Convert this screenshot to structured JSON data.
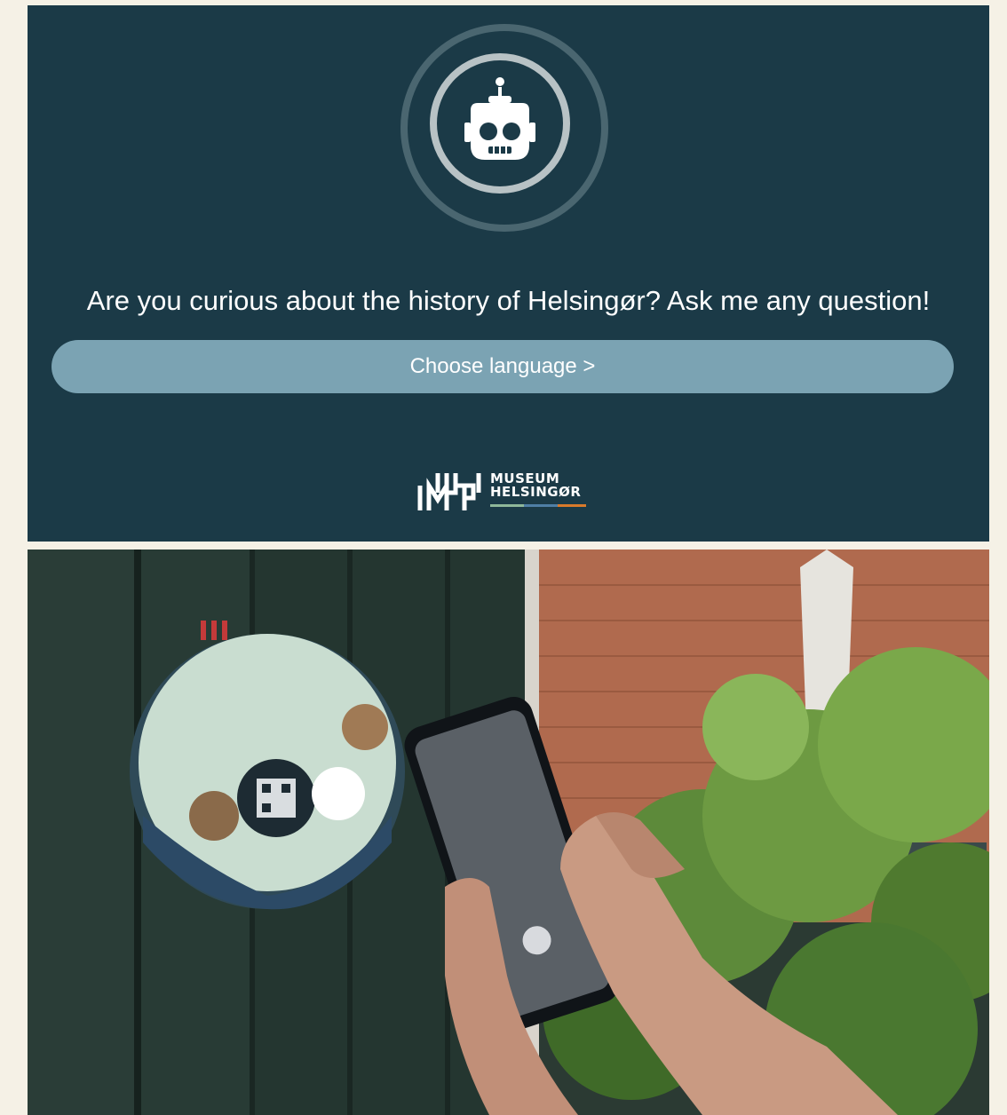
{
  "chat": {
    "avatar_icon": "robot-icon",
    "headline": "Are you curious about the history of Helsingør? Ask me any question!",
    "choose_language_label": "Choose language >"
  },
  "logo": {
    "line1": "MUSEUM",
    "line2": "HELSINGØR"
  },
  "colors": {
    "panel_bg": "#1b3a47",
    "button_bg": "#7ba3b3",
    "page_bg": "#f5f1e6",
    "logo_accent_green": "#8fb89a",
    "logo_accent_blue": "#4f7fa6",
    "logo_accent_orange": "#d97a2b"
  },
  "photo": {
    "subject": "hand-scanning-qr-sign-photo"
  }
}
